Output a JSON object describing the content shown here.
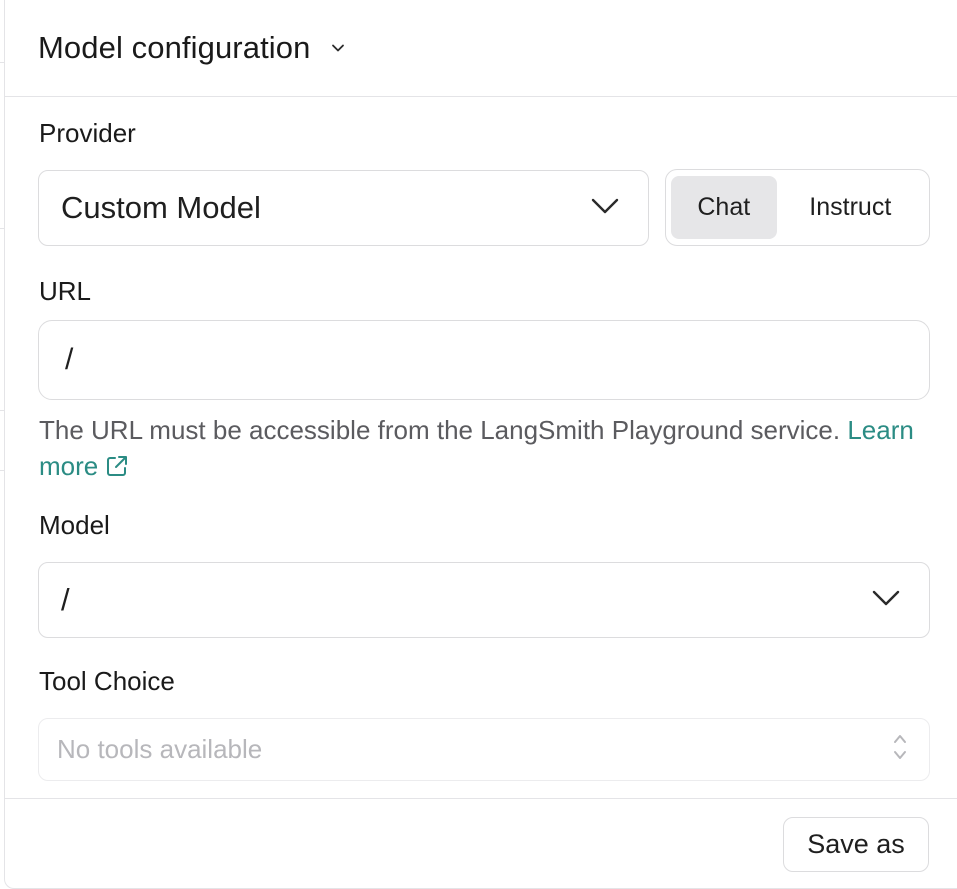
{
  "header": {
    "title": "Model configuration",
    "chevron_icon": "chevron-down-icon"
  },
  "provider": {
    "label": "Provider",
    "selected": "Custom Model",
    "mode_toggle": {
      "options": [
        "Chat",
        "Instruct"
      ],
      "active": "Chat"
    }
  },
  "url": {
    "label": "URL",
    "value": "/",
    "helper_text": "The URL must be accessible from the LangSmith Playground service.",
    "learn_more": "Learn more",
    "link_color": "#2b8c84"
  },
  "model": {
    "label": "Model",
    "selected": "/"
  },
  "tool_choice": {
    "label": "Tool Choice",
    "placeholder": "No tools available"
  },
  "footer": {
    "save_as_label": "Save as"
  }
}
